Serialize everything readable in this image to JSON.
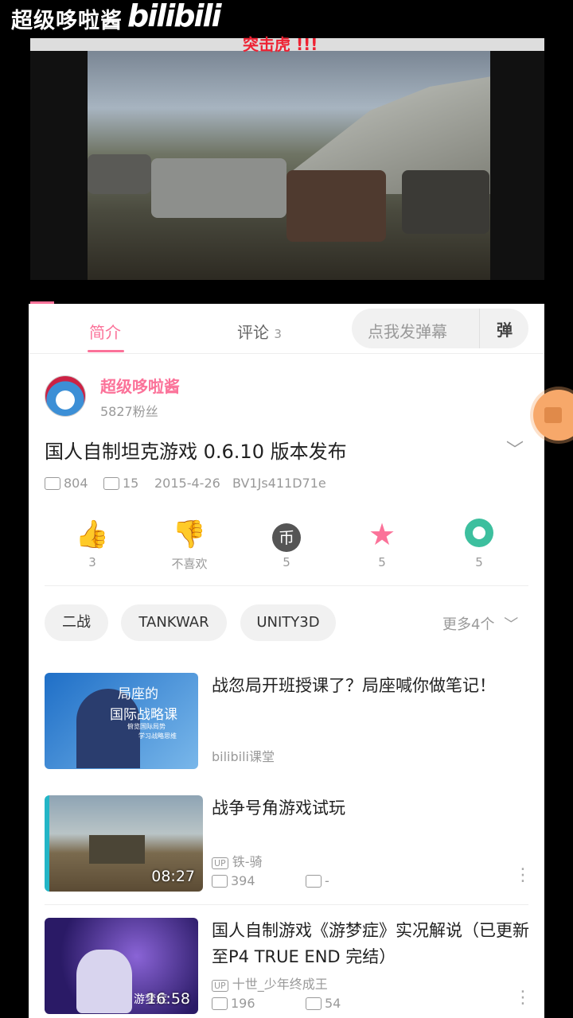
{
  "overlay": {
    "channel_watermark": "超级哆啦酱",
    "logo_text": "bilibili",
    "danmaku": "突击虎 !!!"
  },
  "tabs": {
    "intro": "简介",
    "comments": "评论",
    "comments_count": "3",
    "danmaku_placeholder": "点我发弹幕",
    "danmaku_icon": "弹"
  },
  "uploader": {
    "name": "超级哆啦酱",
    "fans": "5827粉丝"
  },
  "video": {
    "title": "国人自制坦克游戏 0.6.10 版本发布",
    "views": "804",
    "danmaku_count": "15",
    "date": "2015-4-26",
    "bvid": "BV1Js411D71e"
  },
  "actions": {
    "like": "3",
    "dislike": "不喜欢",
    "coin": "5",
    "fav": "5",
    "share": "5",
    "coin_glyph": "币"
  },
  "tags": [
    "二战",
    "TANKWAR",
    "UNITY3D"
  ],
  "more_tags": "更多4个",
  "related": [
    {
      "title": "战忽局开班授课了？局座喊你做笔记！",
      "source": "bilibili课堂",
      "thumb_line1": "局座的",
      "thumb_line2": "国际战略课",
      "thumb_line3": "俯览国际局势",
      "thumb_line4": "学习战略思维"
    },
    {
      "title": "战争号角游戏试玩",
      "up_badge": "UP",
      "uploader": "铁-骑",
      "views": "394",
      "danmaku": "-",
      "duration": "08:27"
    },
    {
      "title": "国人自制游戏《游梦症》实况解说（已更新至P4 TRUE END 完结）",
      "up_badge": "UP",
      "uploader": "十世_少年终成王",
      "views": "196",
      "danmaku": "54",
      "duration": "16:58",
      "thumb_text": "游梦症"
    }
  ],
  "colors": {
    "accent": "#fb7299",
    "text": "#212121",
    "muted": "#999999"
  }
}
